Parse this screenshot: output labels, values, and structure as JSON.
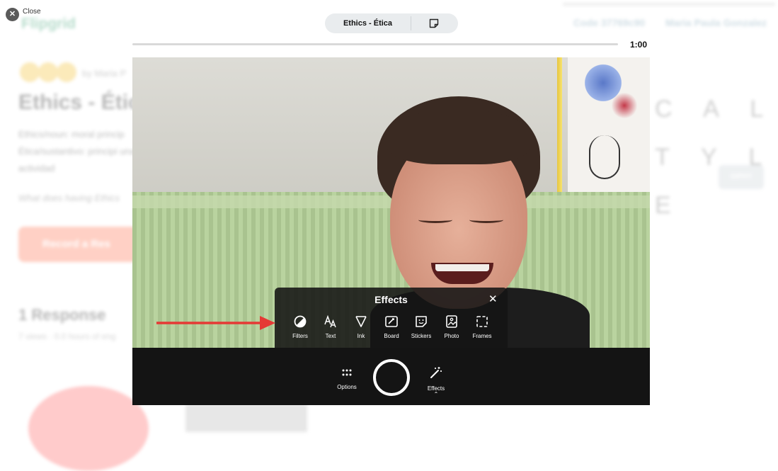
{
  "background": {
    "brand": "Flipgrid",
    "code": "Code 37769c90",
    "user": "Maria Paula Gonzalez",
    "by": "by Maria P",
    "title": "Ethics - Étic",
    "desc": "Ethics/noun: moral princip Ética/sustantivo: principi una actividad",
    "question": "What does having Ethics",
    "record_label": "Record a Res",
    "responses": "1 Response",
    "views": "7 views · 0.0 hours of eng",
    "big_text": "C A L  T Y L E",
    "giphy": "GIPHY"
  },
  "close_label": "Close",
  "topic_pill": {
    "title": "Ethics - Ética"
  },
  "timer": "1:00",
  "effects_panel": {
    "title": "Effects",
    "tools": [
      {
        "label": "Filters",
        "icon": "filters-icon"
      },
      {
        "label": "Text",
        "icon": "text-icon"
      },
      {
        "label": "Ink",
        "icon": "ink-icon"
      },
      {
        "label": "Board",
        "icon": "board-icon"
      },
      {
        "label": "Stickers",
        "icon": "stickers-icon"
      },
      {
        "label": "Photo",
        "icon": "photo-icon"
      },
      {
        "label": "Frames",
        "icon": "frames-icon"
      }
    ]
  },
  "controls": {
    "options_label": "Options",
    "effects_label": "Effects"
  },
  "colors": {
    "annotation_arrow": "#e53935",
    "control_bar": "#141414",
    "panel": "#141414"
  }
}
